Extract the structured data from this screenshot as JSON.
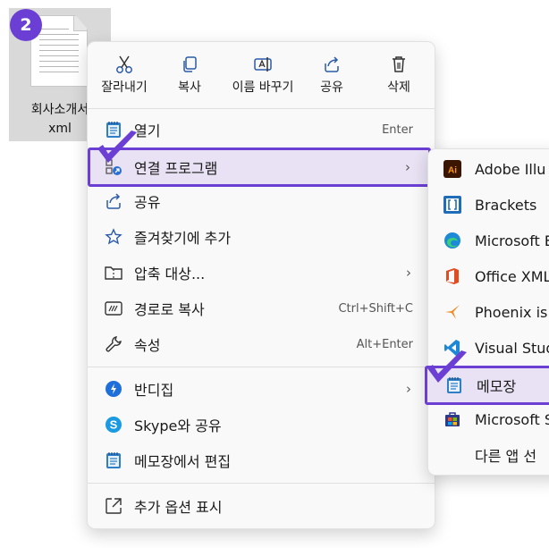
{
  "step_badge": "2",
  "file": {
    "name_line1": "회사소개서",
    "name_line2": "xml"
  },
  "quick_actions": [
    {
      "label": "잘라내기",
      "icon": "scissors-icon"
    },
    {
      "label": "복사",
      "icon": "copy-icon"
    },
    {
      "label": "이름 바꾸기",
      "icon": "rename-icon"
    },
    {
      "label": "공유",
      "icon": "share-icon"
    },
    {
      "label": "삭제",
      "icon": "trash-icon"
    }
  ],
  "menu_items": [
    {
      "label": "열기",
      "shortcut": "Enter",
      "icon": "notepad-icon"
    },
    {
      "label": "연결 프로그램",
      "submenu": true,
      "icon": "open-with-icon",
      "highlighted": true
    },
    {
      "label": "공유",
      "icon": "share-icon"
    },
    {
      "label": "즐겨찾기에 추가",
      "icon": "star-icon"
    },
    {
      "label": "압축 대상...",
      "submenu": true,
      "icon": "zip-folder-icon"
    },
    {
      "label": "경로로 복사",
      "shortcut": "Ctrl+Shift+C",
      "icon": "copy-path-icon"
    },
    {
      "label": "속성",
      "shortcut": "Alt+Enter",
      "icon": "wrench-icon"
    },
    {
      "label": "반디집",
      "submenu": true,
      "icon": "bandizip-icon"
    },
    {
      "label": "Skype와 공유",
      "icon": "skype-icon"
    },
    {
      "label": "메모장에서 편집",
      "icon": "notepad-icon"
    },
    {
      "label": "추가 옵션 표시",
      "icon": "more-options-icon"
    }
  ],
  "submenu_items": [
    {
      "label": "Adobe Illu",
      "icon": "illustrator-icon"
    },
    {
      "label": "Brackets",
      "icon": "brackets-icon"
    },
    {
      "label": "Microsoft E",
      "icon": "edge-icon"
    },
    {
      "label": "Office XML",
      "icon": "office-icon"
    },
    {
      "label": "Phoenix is",
      "icon": "phoenix-icon"
    },
    {
      "label": "Visual Stud",
      "icon": "vscode-icon"
    },
    {
      "label": "메모장",
      "icon": "notepad-icon",
      "highlighted": true
    },
    {
      "label": "Microsoft S",
      "icon": "store-icon"
    },
    {
      "label": "다른 앱 선",
      "icon": ""
    }
  ],
  "colors": {
    "accent": "#6b3fd4",
    "highlight_bg": "#e8e2f4"
  }
}
